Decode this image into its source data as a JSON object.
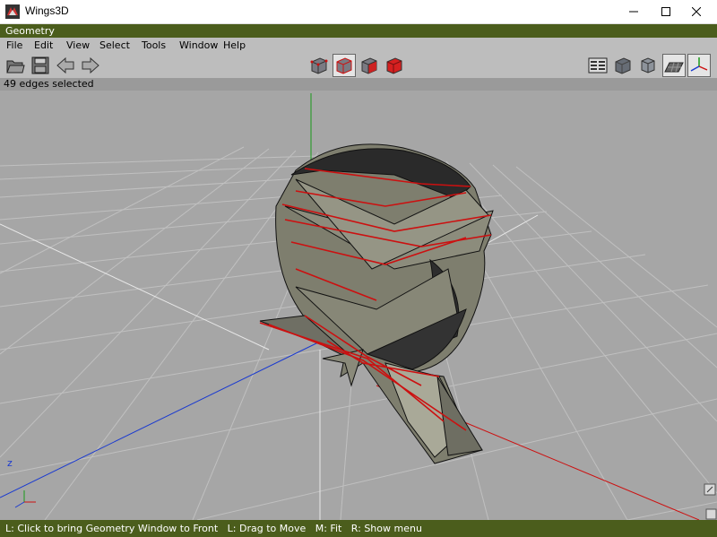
{
  "window": {
    "title": "Wings3D"
  },
  "geometry_window": {
    "title": "Geometry"
  },
  "menu": [
    "File",
    "Edit",
    "View",
    "Select",
    "Tools",
    "Window",
    "Help"
  ],
  "status": {
    "selection": "49 edges selected"
  },
  "help_bar": {
    "text": "L: Click to bring Geometry Window to Front   L: Drag to Move   M: Fit   R: Show menu"
  },
  "axes": {
    "z_label": "z"
  },
  "colors": {
    "accent": "#4b5d1c",
    "menubar": "#bdbdbd",
    "viewport": "#a6a6a6",
    "selection": "#cc1010",
    "mesh": "#7e7e6e"
  },
  "icons": {
    "left": [
      "open-icon",
      "save-icon",
      "undo-icon",
      "redo-icon"
    ],
    "center": [
      "select-vertex-icon",
      "select-edge-icon",
      "select-face-icon",
      "select-body-icon"
    ],
    "right": [
      "info-icon",
      "smooth-shading-icon",
      "orthogonal-view-icon",
      "ground-plane-icon",
      "axes-icon"
    ]
  }
}
